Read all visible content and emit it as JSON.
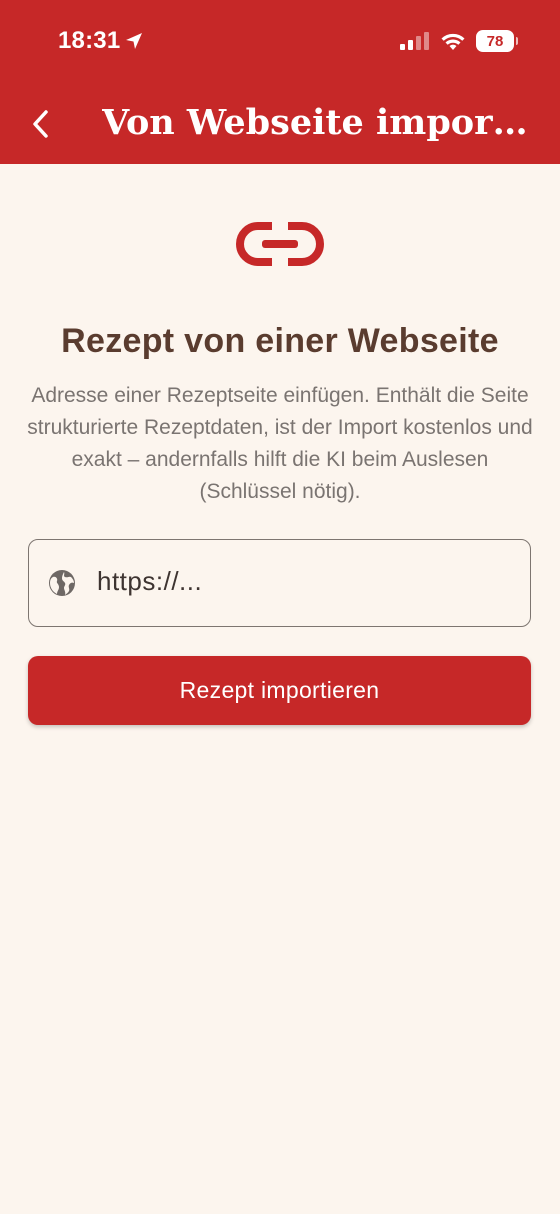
{
  "status_bar": {
    "time": "18:31",
    "battery": "78"
  },
  "app_bar": {
    "title": "Von Webseite importieren",
    "back_icon": "chevron-left-icon"
  },
  "hero": {
    "icon": "link-icon"
  },
  "main": {
    "heading": "Rezept von einer Webseite",
    "description": "Adresse einer Rezeptseite einfügen. Enthält die Seite strukturierte Rezeptdaten, ist der Import kostenlos und exakt – andernfalls hilft die KI beim Auslesen (Schlüssel nötig).",
    "url_input": {
      "placeholder": "https://...",
      "value": "",
      "icon": "globe-icon"
    },
    "import_button": "Rezept importieren"
  },
  "colors": {
    "primary": "#C62828",
    "background": "#FCF5EE",
    "heading": "#5A3C2F",
    "body_text": "#7A7471"
  }
}
